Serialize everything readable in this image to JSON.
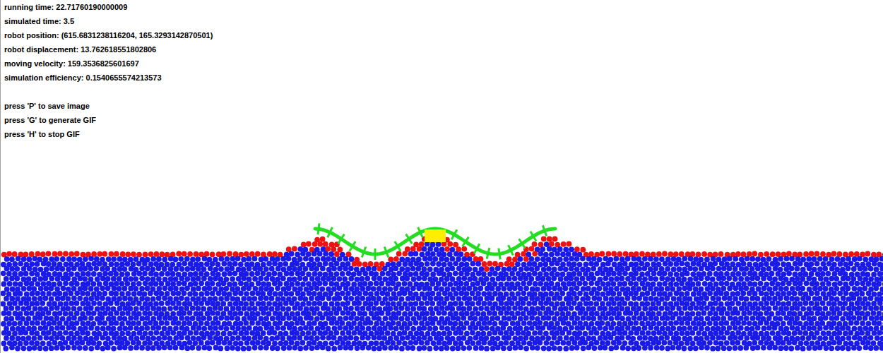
{
  "window": {
    "title": ""
  },
  "info_lines": [
    "running time: 22.71760190000009",
    "simulated time: 3.5",
    "robot position: (615.6831238116204, 165.3293142870501)",
    "robot displacement: 13.762618551802806",
    "moving velocity: 159.3536825601697",
    "simulation efficiency: 0.1540655574213573"
  ],
  "help_lines": [
    "press 'P' to save image",
    "press 'G' to generate GIF",
    "press 'H' to stop GIF"
  ]
}
